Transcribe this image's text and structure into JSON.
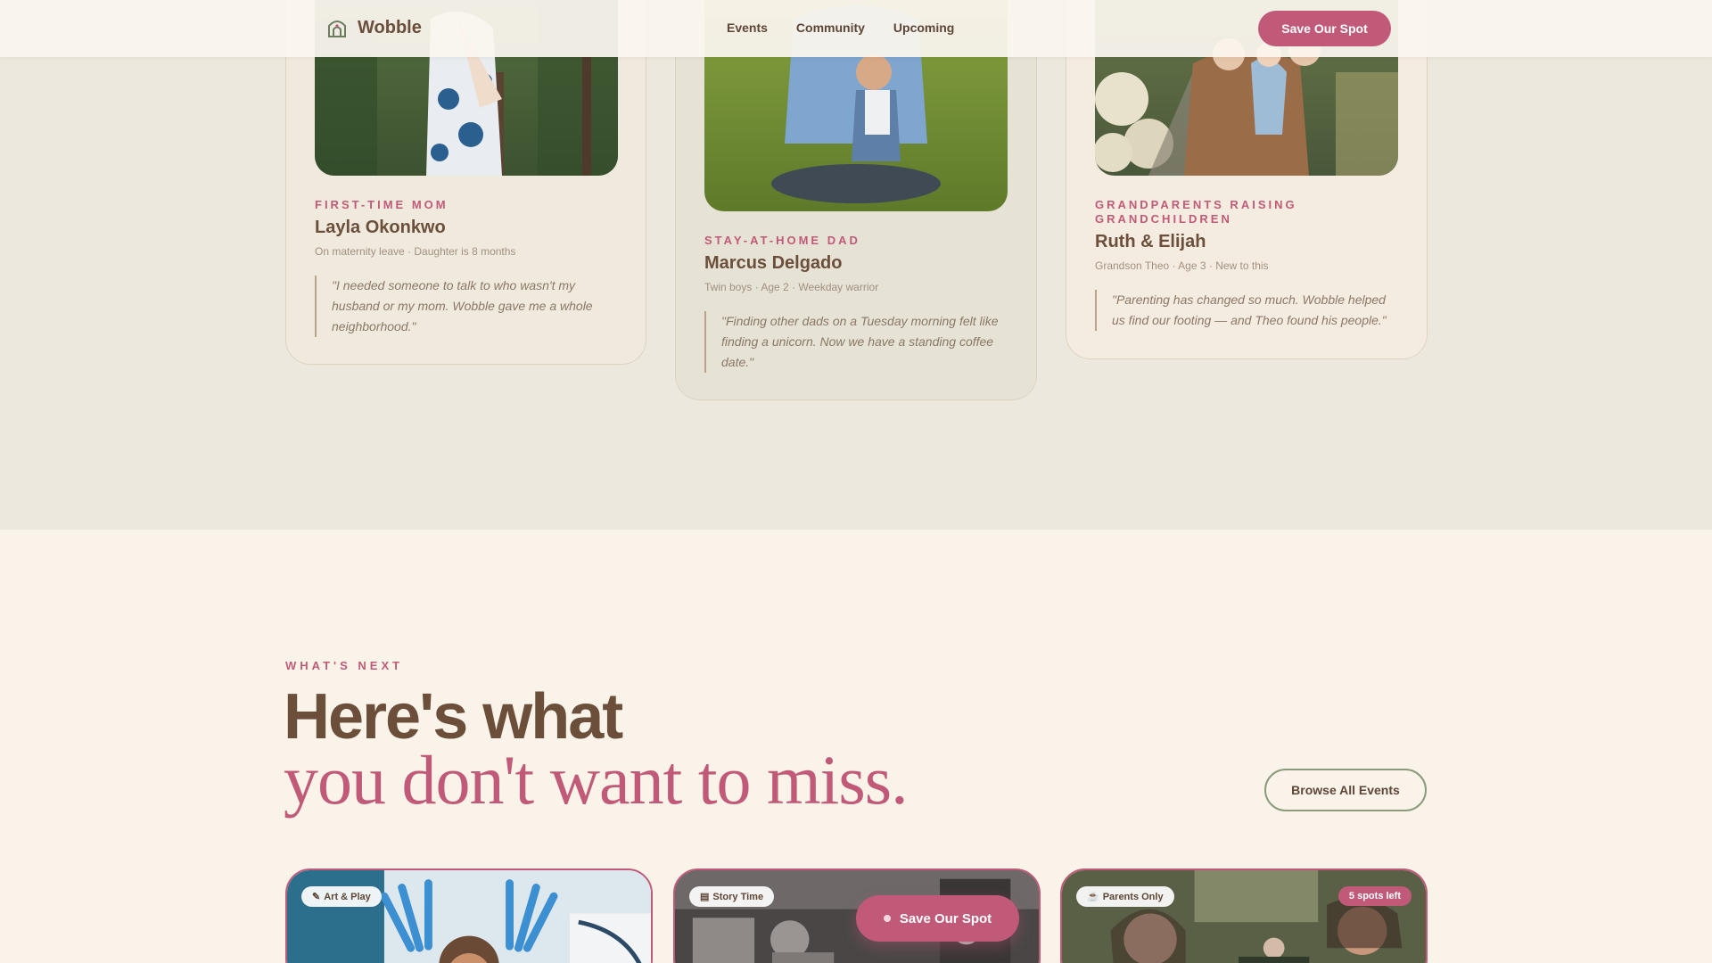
{
  "nav": {
    "brand": "Wobble",
    "links": [
      "Events",
      "Community",
      "Upcoming"
    ],
    "cta": "Save Our Spot"
  },
  "testimonials": [
    {
      "tag": "FIRST-TIME MOM",
      "name": "Layla Okonkwo",
      "meta": "On maternity leave · Daughter is 8 months",
      "quote": "\"I needed someone to talk to who wasn't my husband or my mom. Wobble gave me a whole neighborhood.\""
    },
    {
      "tag": "STAY-AT-HOME DAD",
      "name": "Marcus Delgado",
      "meta": "Twin boys · Age 2 · Weekday warrior",
      "quote": "\"Finding other dads on a Tuesday morning felt like finding a unicorn. Now we have a standing coffee date.\""
    },
    {
      "tag": "GRANDPARENTS RAISING GRANDCHILDREN",
      "name": "Ruth & Elijah",
      "meta": "Grandson Theo · Age 3 · New to this",
      "quote": "\"Parenting has changed so much. Wobble helped us find our footing — and Theo found his people.\""
    }
  ],
  "upcoming": {
    "kicker": "WHAT'S NEXT",
    "headline_1": "Here's what",
    "headline_2": "you don't want to miss.",
    "browse": "Browse All Events",
    "events": [
      {
        "category": "Art & Play",
        "icon": "palette-icon"
      },
      {
        "category": "Story Time",
        "icon": "book-icon"
      },
      {
        "category": "Parents Only",
        "icon": "coffee-icon",
        "badge": "5 spots left"
      }
    ],
    "floating_cta": "Save Our Spot"
  }
}
